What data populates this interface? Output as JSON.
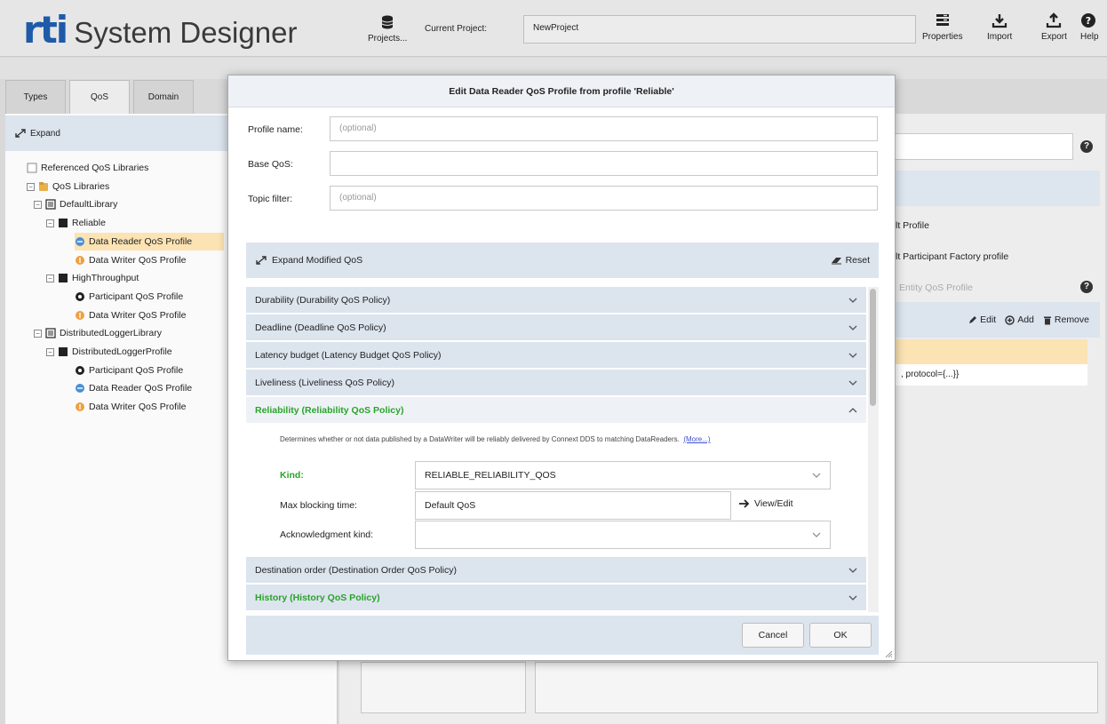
{
  "app": {
    "brand_rti": "rti",
    "brand_name": "System Designer"
  },
  "header": {
    "projects_label": "Projects...",
    "current_project_label": "Current Project:",
    "current_project_value": "NewProject",
    "actions": [
      {
        "label": "Properties",
        "icon": "properties-icon"
      },
      {
        "label": "Import",
        "icon": "import-icon"
      },
      {
        "label": "Export",
        "icon": "export-icon"
      },
      {
        "label": "Help",
        "icon": "help-icon"
      }
    ]
  },
  "left": {
    "tabs": [
      "Types",
      "QoS",
      "Domain"
    ],
    "active_tab": "QoS",
    "expand_label": "Expand",
    "tree": [
      {
        "label": "Referenced QoS Libraries",
        "icon": "checkbox-icon",
        "level": 0
      },
      {
        "label": "QoS Libraries",
        "icon": "library-folder-icon",
        "level": 0
      },
      {
        "label": "DefaultLibrary",
        "icon": "library-icon",
        "level": 1
      },
      {
        "label": "Reliable",
        "icon": "profile-icon",
        "level": 2
      },
      {
        "label": "Data Reader QoS Profile",
        "icon": "data-reader-icon",
        "level": 3,
        "selected": true
      },
      {
        "label": "Data Writer QoS Profile",
        "icon": "data-writer-icon",
        "level": 3
      },
      {
        "label": "HighThroughput",
        "icon": "profile-icon",
        "level": 2
      },
      {
        "label": "Participant QoS Profile",
        "icon": "participant-icon",
        "level": 3
      },
      {
        "label": "Data Writer QoS Profile",
        "icon": "data-writer-icon",
        "level": 3
      },
      {
        "label": "DistributedLoggerLibrary",
        "icon": "library-icon",
        "level": 1
      },
      {
        "label": "DistributedLoggerProfile",
        "icon": "profile-icon",
        "level": 2
      },
      {
        "label": "Participant QoS Profile",
        "icon": "participant-icon",
        "level": 3
      },
      {
        "label": "Data Reader QoS Profile",
        "icon": "data-reader-icon",
        "level": 3
      },
      {
        "label": "Data Writer QoS Profile",
        "icon": "data-writer-icon",
        "level": 3
      }
    ]
  },
  "right": {
    "row1": "lt Profile",
    "row2": "lt Participant Factory profile",
    "row3": "Entity QoS Profile",
    "toolbar": {
      "edit": "Edit",
      "add": "Add",
      "remove": "Remove"
    },
    "cell_value": ", protocol={...}}"
  },
  "modal": {
    "title": "Edit Data Reader QoS Profile from profile 'Reliable'",
    "profile_name_label": "Profile name:",
    "profile_name_placeholder": "(optional)",
    "base_qos_label": "Base QoS:",
    "base_qos_value": "",
    "topic_filter_label": "Topic filter:",
    "topic_filter_placeholder": "(optional)",
    "expand_modified_label": "Expand Modified QoS",
    "reset_label": "Reset",
    "policies_top": [
      {
        "label": "Durability (Durability QoS Policy)",
        "modified": false
      },
      {
        "label": "Deadline (Deadline QoS Policy)",
        "modified": false
      },
      {
        "label": "Latency budget (Latency Budget QoS Policy)",
        "modified": false
      },
      {
        "label": "Liveliness (Liveliness QoS Policy)",
        "modified": false
      }
    ],
    "open_policy": {
      "label": "Reliability (Reliability QoS Policy)",
      "description": "Determines whether or not data published by a DataWriter will be reliably delivered by Connext DDS to matching DataReaders.",
      "more_link": "(More...)",
      "kind_label": "Kind:",
      "kind_value": "RELIABLE_RELIABILITY_QOS",
      "max_blocking_label": "Max blocking time:",
      "max_blocking_value": "Default QoS",
      "view_edit_label": "View/Edit",
      "ack_kind_label": "Acknowledgment kind:",
      "ack_kind_value": ""
    },
    "policies_bottom": [
      {
        "label": "Destination order (Destination Order QoS Policy)",
        "modified": false
      },
      {
        "label": "History (History QoS Policy)",
        "modified": true
      }
    ],
    "cancel_label": "Cancel",
    "ok_label": "OK"
  },
  "colors": {
    "accent_blue": "#1f5aa8",
    "modified_green": "#2aa32a",
    "selection_orange": "#fbe3b3",
    "panel_blue": "#dce4ee"
  }
}
